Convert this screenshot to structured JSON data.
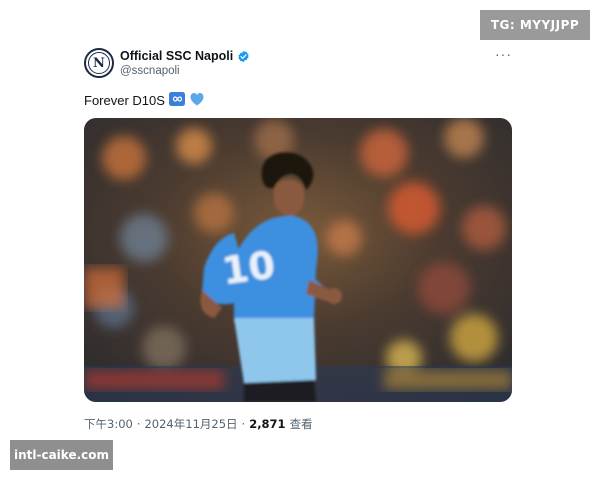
{
  "watermarks": {
    "top_right": "TG: MYYJJPP",
    "bottom_left": "intl-caike.com"
  },
  "tweet": {
    "author": {
      "display_name": "Official SSC Napoli",
      "handle": "@sscnapoli",
      "avatar_letter": "N",
      "verified": true
    },
    "text": "Forever D10S",
    "emojis": [
      "infinity-emoji",
      "light-blue-heart-emoji"
    ],
    "image": {
      "description_icon": "photo",
      "jersey_number": "10"
    },
    "meta": {
      "time": "下午3:00",
      "separator": "·",
      "date": "2024年11月25日",
      "views_count": "2,871",
      "views_label": "查看"
    }
  },
  "colors": {
    "verified": "#1d9bf0",
    "heart": "#5aa8e8",
    "jersey": "#3d8fe0",
    "text_secondary": "#536471"
  }
}
